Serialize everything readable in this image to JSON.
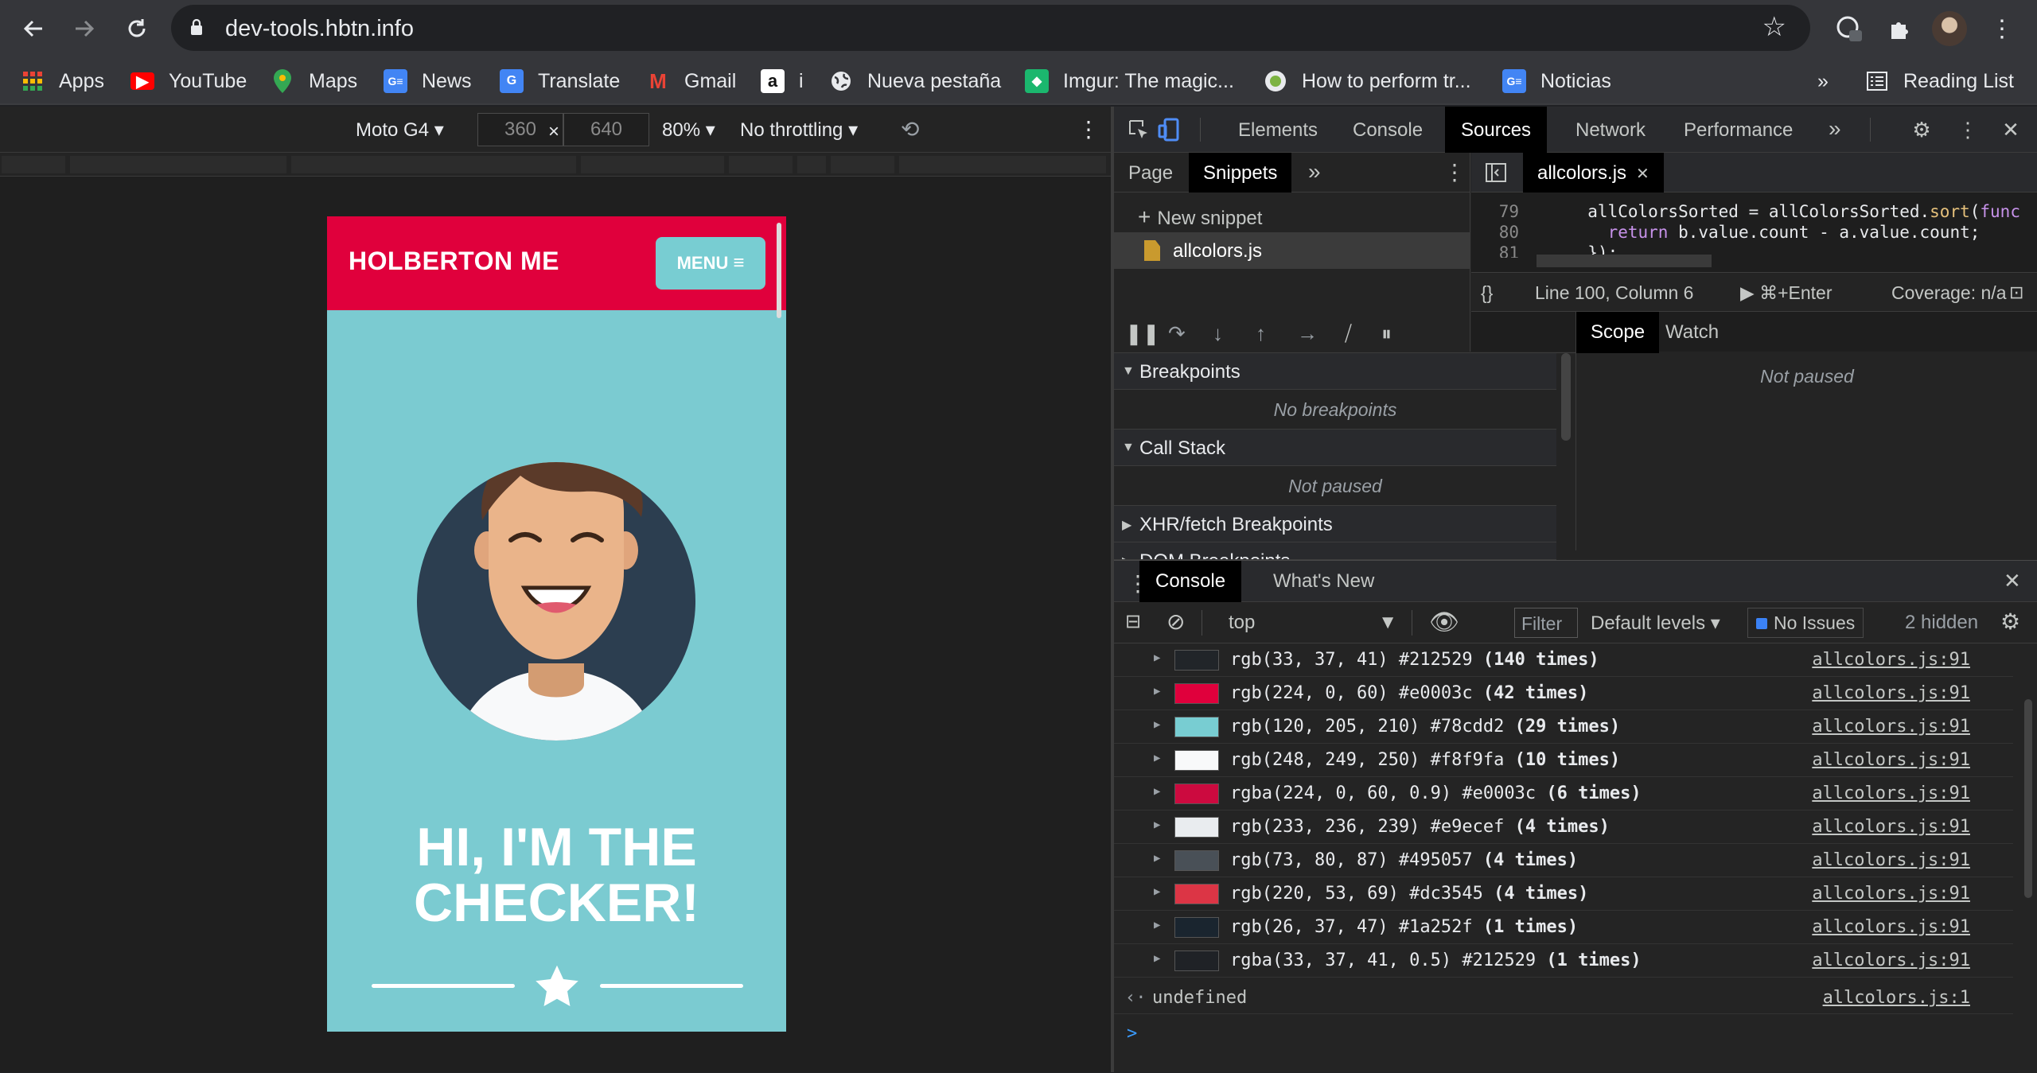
{
  "browser": {
    "url": "dev-tools.hbtn.info",
    "bookmarks": [
      {
        "label": "Apps",
        "icon": "apps-grid-icon",
        "color": "#ea4335"
      },
      {
        "label": "YouTube",
        "icon": "youtube-icon",
        "color": "#ff0000"
      },
      {
        "label": "Maps",
        "icon": "maps-pin-icon",
        "color": "#34a853"
      },
      {
        "label": "News",
        "icon": "google-news-icon",
        "color": "#4285f4"
      },
      {
        "label": "Translate",
        "icon": "google-translate-icon",
        "color": "#4285f4"
      },
      {
        "label": "Gmail",
        "icon": "gmail-icon",
        "color": "#ea4335"
      },
      {
        "label": "i",
        "icon": "amazon-icon",
        "color": "#ffffff"
      },
      {
        "label": "Nueva pestaña",
        "icon": "globe-icon",
        "color": "#e8eaed"
      },
      {
        "label": "Imgur: The magic...",
        "icon": "imgur-icon",
        "color": "#1bb76e"
      },
      {
        "label": "How to perform tr...",
        "icon": "circle-site-icon",
        "color": "#7cb342"
      },
      {
        "label": "Noticias",
        "icon": "google-news-icon",
        "color": "#4285f4"
      }
    ],
    "overflow": "»",
    "reading_list": "Reading List"
  },
  "device_toolbar": {
    "device": "Moto G4",
    "width": "360",
    "height": "640",
    "times": "×",
    "zoom": "80%",
    "throttling": "No throttling"
  },
  "site": {
    "logo": "HOLBERTON ME",
    "menu": "MENU",
    "hero_line1": "HI, I'M THE",
    "hero_line2": "CHECKER!",
    "colors": {
      "header": "#e0003c",
      "bg": "#7bcbd1",
      "button": "#78cdd2"
    }
  },
  "devtools": {
    "tabs": [
      "Elements",
      "Console",
      "Sources",
      "Network",
      "Performance"
    ],
    "active_tab": "Sources",
    "more": "»",
    "navigator": {
      "tabs": [
        "Page",
        "Snippets"
      ],
      "active": "Snippets",
      "more": "»",
      "new_snippet": "New snippet",
      "items": [
        "allcolors.js"
      ]
    },
    "editor": {
      "file_tab": "allcolors.js",
      "lines": [
        {
          "n": "79",
          "code_a": "  allColorsSorted = allColorsSorted.",
          "code_fn": "sort",
          "code_b": "(",
          "code_kw": "func"
        },
        {
          "n": "80",
          "code_a": "    ",
          "code_kw2": "return",
          "code_c": " b.value.count - a.value.count;"
        },
        {
          "n": "81",
          "code_a": "  });"
        }
      ],
      "status_brace": "{}",
      "position": "Line 100, Column 6",
      "run": "▶ ⌘+Enter",
      "coverage": "Coverage: n/a"
    },
    "debugger": {
      "sections": [
        {
          "title": "Breakpoints",
          "body": "No breakpoints",
          "open": true
        },
        {
          "title": "Call Stack",
          "body": "Not paused",
          "open": true
        },
        {
          "title": "XHR/fetch Breakpoints",
          "open": false
        },
        {
          "title": "DOM Breakpoints",
          "open": false
        }
      ],
      "scope_tabs": [
        "Scope",
        "Watch"
      ],
      "scope_active": "Scope",
      "scope_body": "Not paused"
    },
    "drawer": {
      "tabs": [
        "Console",
        "What's New"
      ],
      "active": "Console",
      "context": "top",
      "filter_placeholder": "Filter",
      "levels": "Default levels",
      "issues": "No Issues",
      "hidden": "2 hidden",
      "logs": [
        {
          "swatch": "#212529",
          "text": "rgb(33, 37, 41) #212529",
          "count": "(140 times)",
          "src": "allcolors.js:91"
        },
        {
          "swatch": "#e0003c",
          "text": "rgb(224, 0, 60) #e0003c",
          "count": "(42 times)",
          "src": "allcolors.js:91"
        },
        {
          "swatch": "#78cdd2",
          "text": "rgb(120, 205, 210) #78cdd2",
          "count": "(29 times)",
          "src": "allcolors.js:91"
        },
        {
          "swatch": "#f8f9fa",
          "text": "rgb(248, 249, 250) #f8f9fa",
          "count": "(10 times)",
          "src": "allcolors.js:91"
        },
        {
          "swatch": "#cc0a3f",
          "text": "rgba(224, 0, 60, 0.9) #e0003c",
          "count": "(6 times)",
          "src": "allcolors.js:91"
        },
        {
          "swatch": "#e9ecef",
          "text": "rgb(233, 236, 239) #e9ecef",
          "count": "(4 times)",
          "src": "allcolors.js:91"
        },
        {
          "swatch": "#495057",
          "text": "rgb(73, 80, 87) #495057",
          "count": "(4 times)",
          "src": "allcolors.js:91"
        },
        {
          "swatch": "#dc3545",
          "text": "rgb(220, 53, 69) #dc3545",
          "count": "(4 times)",
          "src": "allcolors.js:91"
        },
        {
          "swatch": "#1a252f",
          "text": "rgb(26, 37, 47) #1a252f",
          "count": "(1 times)",
          "src": "allcolors.js:91"
        },
        {
          "swatch": "#1f2226",
          "text": "rgba(33, 37, 41, 0.5) #212529",
          "count": "(1 times)",
          "src": "allcolors.js:91"
        }
      ],
      "result": "undefined",
      "result_src": "allcolors.js:1"
    }
  }
}
